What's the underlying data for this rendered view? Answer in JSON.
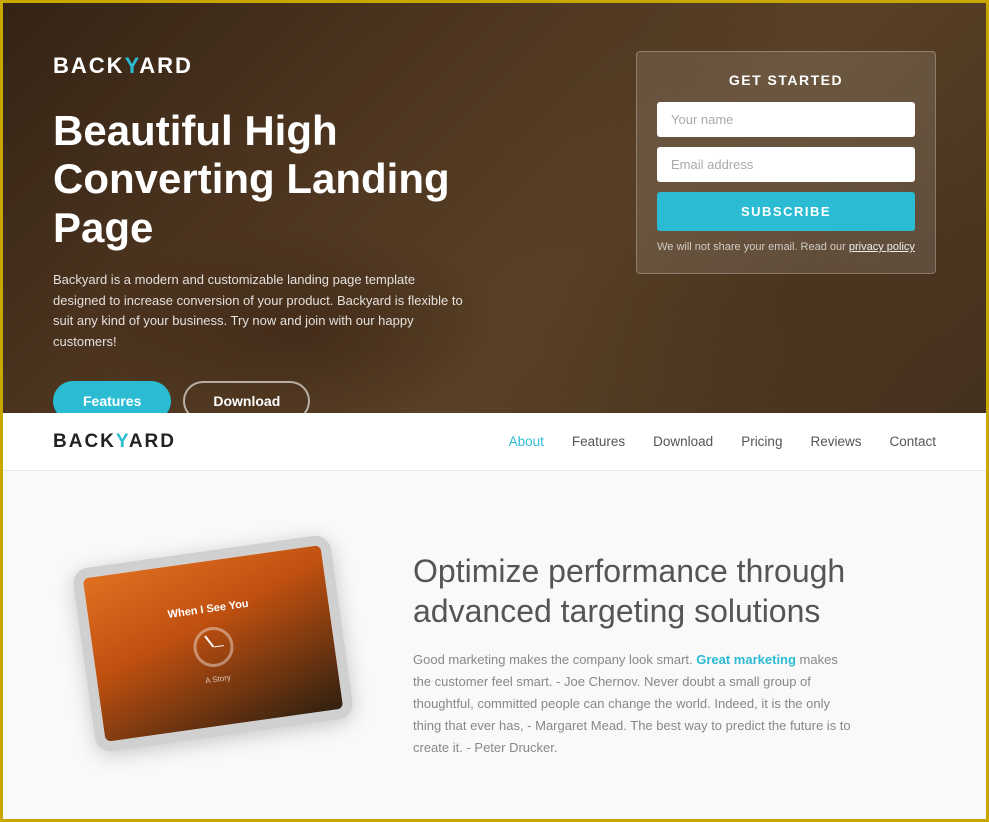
{
  "hero": {
    "logo": "BACK",
    "logo_y": "Y",
    "logo_rest": "ARD",
    "title": "Beautiful High Converting Landing Page",
    "description": "Backyard is a modern and customizable landing page template designed to increase conversion of your product. Backyard is flexible to suit any kind of your business. Try now and join with our happy customers!",
    "btn_features": "Features",
    "btn_download": "Download"
  },
  "form": {
    "title": "GET STARTED",
    "name_placeholder": "Your name",
    "email_placeholder": "Email address",
    "subscribe_label": "SUBSCRIBE",
    "privacy_text": "We will not share your email. Read our ",
    "privacy_link": "privacy policy"
  },
  "navbar": {
    "logo": "BACK",
    "logo_y": "Y",
    "logo_rest": "ARD",
    "links": [
      {
        "label": "About",
        "active": true
      },
      {
        "label": "Features",
        "active": false
      },
      {
        "label": "Download",
        "active": false
      },
      {
        "label": "Pricing",
        "active": false
      },
      {
        "label": "Reviews",
        "active": false
      },
      {
        "label": "Contact",
        "active": false
      }
    ]
  },
  "main": {
    "heading": "Optimize performance through advanced targeting solutions",
    "body_before_highlight": "Good marketing makes the company look smart. ",
    "highlight": "Great marketing",
    "body_after_highlight": " makes the customer feel smart. - Joe Chernov. Never doubt a small group of thoughtful, committed people can change the world. Indeed, it is the only thing that ever has, - Margaret Mead. The best way to predict the future is to create it. - Peter Drucker.",
    "tablet_title": "When I See You",
    "tablet_subtitle": "A Story"
  }
}
